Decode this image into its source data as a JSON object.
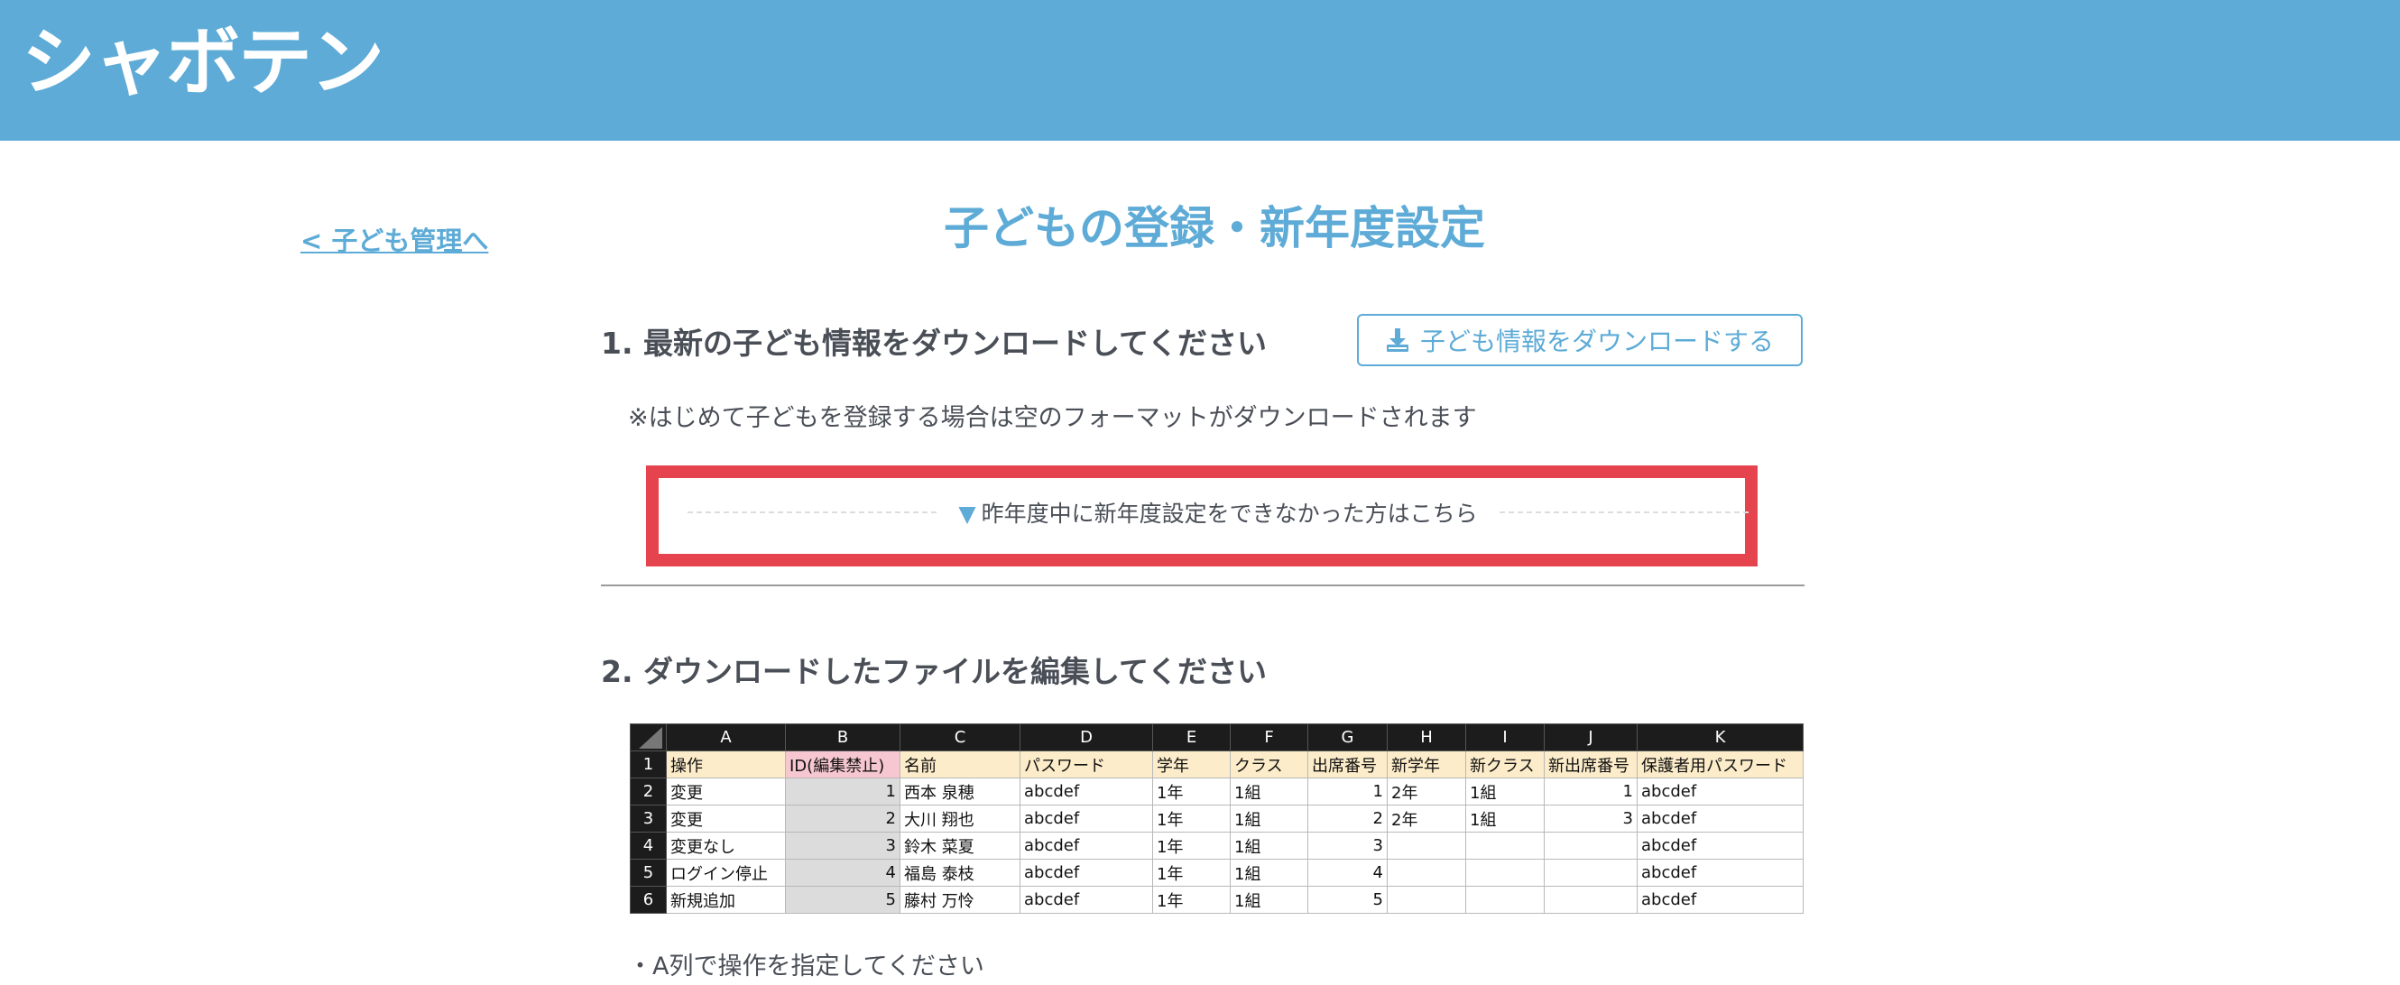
{
  "header": {
    "logo_text": "シャボテン"
  },
  "nav": {
    "back_link": "< 子ども管理へ"
  },
  "page": {
    "title": "子どもの登録・新年度設定"
  },
  "step1": {
    "heading": "1. 最新の子ども情報をダウンロードしてください",
    "download_button": "子ども情報をダウンロードする",
    "download_icon": "download-icon",
    "note": "※はじめて子どもを登録する場合は空のフォーマットがダウンロードされます",
    "toggle_marker": "▼",
    "toggle_text": "昨年度中に新年度設定をできなかった方はこちら"
  },
  "step2": {
    "heading": "2. ダウンロードしたファイルを編集してください",
    "instruction_partial": "・A列で操作を指定してください"
  },
  "spreadsheet": {
    "column_letters": [
      "A",
      "B",
      "C",
      "D",
      "E",
      "F",
      "G",
      "H",
      "I",
      "J",
      "K"
    ],
    "row_numbers": [
      "1",
      "2",
      "3",
      "4",
      "5",
      "6"
    ],
    "fields": [
      "操作",
      "ID(編集禁止)",
      "名前",
      "パスワード",
      "学年",
      "クラス",
      "出席番号",
      "新学年",
      "新クラス",
      "新出席番号",
      "保護者用パスワード"
    ],
    "rows": [
      [
        "変更",
        "1",
        "西本 泉穂",
        "abcdef",
        "1年",
        "1組",
        "1",
        "2年",
        "1組",
        "1",
        "abcdef"
      ],
      [
        "変更",
        "2",
        "大川 翔也",
        "abcdef",
        "1年",
        "1組",
        "2",
        "2年",
        "1組",
        "3",
        "abcdef"
      ],
      [
        "変更なし",
        "3",
        "鈴木 菜夏",
        "abcdef",
        "1年",
        "1組",
        "3",
        "",
        "",
        "",
        "abcdef"
      ],
      [
        "ログイン停止",
        "4",
        "福島 泰枝",
        "abcdef",
        "1年",
        "1組",
        "4",
        "",
        "",
        "",
        "abcdef"
      ],
      [
        "新規追加",
        "5",
        "藤村 万怜",
        "abcdef",
        "1年",
        "1組",
        "5",
        "",
        "",
        "",
        "abcdef"
      ]
    ]
  },
  "colors": {
    "header_bg": "#5dabd6",
    "accent": "#5dabd6",
    "highlight_border": "#e5444e",
    "field_row_bg": "#fcecc9",
    "id_field_bg": "#f6c7d0",
    "id_cell_bg": "#dcdcdc"
  }
}
